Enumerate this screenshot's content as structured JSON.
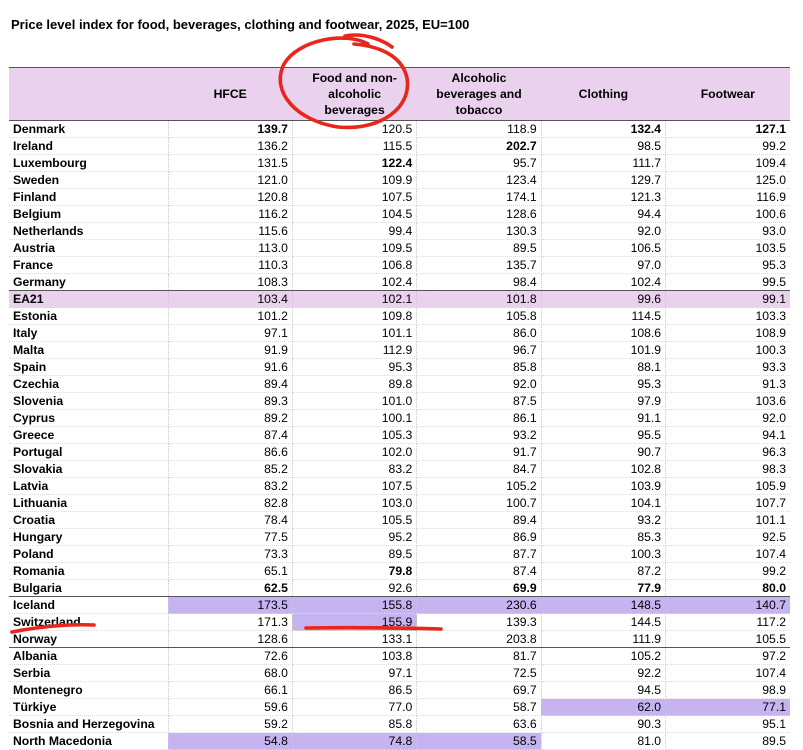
{
  "title": "Price level index for food, beverages, clothing and footwear, 2025, EU=100",
  "table": {
    "columns": [
      "",
      "HFCE",
      "Food and non-alcoholic beverages",
      "Alcoholic beverages and tobacco",
      "Clothing",
      "Footwear"
    ],
    "header_lines": {
      "food": [
        "Food and non-",
        "alcoholic",
        "beverages"
      ],
      "alcohol": [
        "Alcoholic",
        "beverages and",
        "tobacco"
      ]
    },
    "rows": [
      {
        "country": "Denmark",
        "values": [
          "139.7",
          "120.5",
          "118.9",
          "132.4",
          "127.1"
        ],
        "bold": [
          true,
          false,
          false,
          true,
          true
        ]
      },
      {
        "country": "Ireland",
        "values": [
          "136.2",
          "115.5",
          "202.7",
          "98.5",
          "99.2"
        ],
        "bold": [
          false,
          false,
          true,
          false,
          false
        ]
      },
      {
        "country": "Luxembourg",
        "values": [
          "131.5",
          "122.4",
          "95.7",
          "111.7",
          "109.4"
        ],
        "bold": [
          false,
          true,
          false,
          false,
          false
        ]
      },
      {
        "country": "Sweden",
        "values": [
          "121.0",
          "109.9",
          "123.4",
          "129.7",
          "125.0"
        ]
      },
      {
        "country": "Finland",
        "values": [
          "120.8",
          "107.5",
          "174.1",
          "121.3",
          "116.9"
        ]
      },
      {
        "country": "Belgium",
        "values": [
          "116.2",
          "104.5",
          "128.6",
          "94.4",
          "100.6"
        ]
      },
      {
        "country": "Netherlands",
        "values": [
          "115.6",
          "99.4",
          "130.3",
          "92.0",
          "93.0"
        ]
      },
      {
        "country": "Austria",
        "values": [
          "113.0",
          "109.5",
          "89.5",
          "106.5",
          "103.5"
        ]
      },
      {
        "country": "France",
        "values": [
          "110.3",
          "106.8",
          "135.7",
          "97.0",
          "95.3"
        ]
      },
      {
        "country": "Germany",
        "values": [
          "108.3",
          "102.4",
          "98.4",
          "102.4",
          "99.5"
        ]
      },
      {
        "country": "EA21",
        "values": [
          "103.4",
          "102.1",
          "101.8",
          "99.6",
          "99.1"
        ],
        "type": "aggregate"
      },
      {
        "country": "Estonia",
        "values": [
          "101.2",
          "109.8",
          "105.8",
          "114.5",
          "103.3"
        ]
      },
      {
        "country": "Italy",
        "values": [
          "97.1",
          "101.1",
          "86.0",
          "108.6",
          "108.9"
        ]
      },
      {
        "country": "Malta",
        "values": [
          "91.9",
          "112.9",
          "96.7",
          "101.9",
          "100.3"
        ]
      },
      {
        "country": "Spain",
        "values": [
          "91.6",
          "95.3",
          "85.8",
          "88.1",
          "93.3"
        ]
      },
      {
        "country": "Czechia",
        "values": [
          "89.4",
          "89.8",
          "92.0",
          "95.3",
          "91.3"
        ]
      },
      {
        "country": "Slovenia",
        "values": [
          "89.3",
          "101.0",
          "87.5",
          "97.9",
          "103.6"
        ]
      },
      {
        "country": "Cyprus",
        "values": [
          "89.2",
          "100.1",
          "86.1",
          "91.1",
          "92.0"
        ]
      },
      {
        "country": "Greece",
        "values": [
          "87.4",
          "105.3",
          "93.2",
          "95.5",
          "94.1"
        ]
      },
      {
        "country": "Portugal",
        "values": [
          "86.6",
          "102.0",
          "91.7",
          "90.7",
          "96.3"
        ]
      },
      {
        "country": "Slovakia",
        "values": [
          "85.2",
          "83.2",
          "84.7",
          "102.8",
          "98.3"
        ]
      },
      {
        "country": "Latvia",
        "values": [
          "83.2",
          "107.5",
          "105.2",
          "103.9",
          "105.9"
        ]
      },
      {
        "country": "Lithuania",
        "values": [
          "82.8",
          "103.0",
          "100.7",
          "104.1",
          "107.7"
        ]
      },
      {
        "country": "Croatia",
        "values": [
          "78.4",
          "105.5",
          "89.4",
          "93.2",
          "101.1"
        ]
      },
      {
        "country": "Hungary",
        "values": [
          "77.5",
          "95.2",
          "86.9",
          "85.3",
          "92.5"
        ]
      },
      {
        "country": "Poland",
        "values": [
          "73.3",
          "89.5",
          "87.7",
          "100.3",
          "107.4"
        ]
      },
      {
        "country": "Romania",
        "values": [
          "65.1",
          "79.8",
          "87.4",
          "87.2",
          "99.2"
        ],
        "bold": [
          false,
          true,
          false,
          false,
          false
        ]
      },
      {
        "country": "Bulgaria",
        "values": [
          "62.5",
          "92.6",
          "69.9",
          "77.9",
          "80.0"
        ],
        "bold": [
          true,
          false,
          true,
          true,
          true
        ]
      },
      {
        "country": "Iceland",
        "values": [
          "173.5",
          "155.8",
          "230.6",
          "148.5",
          "140.7"
        ],
        "highlight": [
          true,
          true,
          true,
          true,
          true
        ],
        "type": "group-start"
      },
      {
        "country": "Switzerland",
        "values": [
          "171.3",
          "155.9",
          "139.3",
          "144.5",
          "117.2"
        ],
        "highlight": [
          false,
          true,
          false,
          false,
          false
        ]
      },
      {
        "country": "Norway",
        "values": [
          "128.6",
          "133.1",
          "203.8",
          "111.9",
          "105.5"
        ]
      },
      {
        "country": "Albania",
        "values": [
          "72.6",
          "103.8",
          "81.7",
          "105.2",
          "97.2"
        ],
        "type": "group-start"
      },
      {
        "country": "Serbia",
        "values": [
          "68.0",
          "97.1",
          "72.5",
          "92.2",
          "107.4"
        ]
      },
      {
        "country": "Montenegro",
        "values": [
          "66.1",
          "86.5",
          "69.7",
          "94.5",
          "98.9"
        ]
      },
      {
        "country": "Türkiye",
        "values": [
          "59.6",
          "77.0",
          "58.7",
          "62.0",
          "77.1"
        ],
        "highlight": [
          false,
          false,
          false,
          true,
          true
        ]
      },
      {
        "country": "Bosnia and Herzegovina",
        "values": [
          "59.2",
          "85.8",
          "63.6",
          "90.3",
          "95.1"
        ]
      },
      {
        "country": "North Macedonia",
        "values": [
          "54.8",
          "74.8",
          "58.5",
          "81.0",
          "89.5"
        ],
        "highlight": [
          true,
          true,
          true,
          false,
          false
        ]
      }
    ]
  },
  "annotation_color": "#e8261c"
}
